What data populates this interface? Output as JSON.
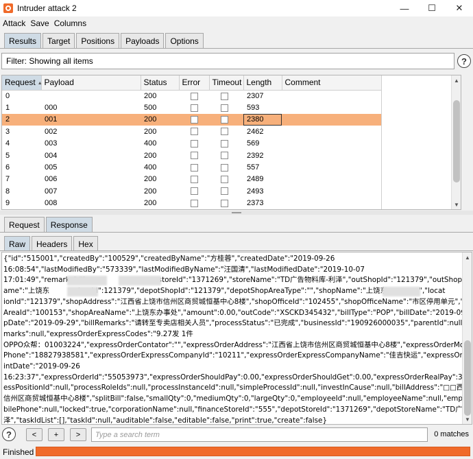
{
  "window": {
    "title": "Intruder attack 2"
  },
  "menu": [
    "Attack",
    "Save",
    "Columns"
  ],
  "main_tabs": [
    "Results",
    "Target",
    "Positions",
    "Payloads",
    "Options"
  ],
  "main_tabs_active": "Results",
  "filter": {
    "text": "Filter: Showing all items"
  },
  "table": {
    "columns": [
      "Request",
      "Payload",
      "Status",
      "Error",
      "Timeout",
      "Length",
      "Comment"
    ],
    "rows": [
      {
        "request": "0",
        "payload": "",
        "status": "200",
        "error": false,
        "timeout": false,
        "length": "2307",
        "comment": ""
      },
      {
        "request": "1",
        "payload": "000",
        "status": "500",
        "error": false,
        "timeout": false,
        "length": "593",
        "comment": ""
      },
      {
        "request": "2",
        "payload": "001",
        "status": "200",
        "error": false,
        "timeout": false,
        "length": "2380",
        "comment": ""
      },
      {
        "request": "3",
        "payload": "002",
        "status": "200",
        "error": false,
        "timeout": false,
        "length": "2462",
        "comment": ""
      },
      {
        "request": "4",
        "payload": "003",
        "status": "400",
        "error": false,
        "timeout": false,
        "length": "569",
        "comment": ""
      },
      {
        "request": "5",
        "payload": "004",
        "status": "200",
        "error": false,
        "timeout": false,
        "length": "2392",
        "comment": ""
      },
      {
        "request": "6",
        "payload": "005",
        "status": "400",
        "error": false,
        "timeout": false,
        "length": "557",
        "comment": ""
      },
      {
        "request": "7",
        "payload": "006",
        "status": "200",
        "error": false,
        "timeout": false,
        "length": "2489",
        "comment": ""
      },
      {
        "request": "8",
        "payload": "007",
        "status": "200",
        "error": false,
        "timeout": false,
        "length": "2493",
        "comment": ""
      },
      {
        "request": "9",
        "payload": "008",
        "status": "200",
        "error": false,
        "timeout": false,
        "length": "2373",
        "comment": ""
      }
    ],
    "selected_row": 2
  },
  "detail_tabs": [
    "Request",
    "Response"
  ],
  "detail_tabs_active": "Response",
  "view_tabs": [
    "Raw",
    "Headers",
    "Hex"
  ],
  "view_tabs_active": "Raw",
  "response_lines": [
    "{\"id\":\"515001\",\"createdBy\":\"100529\",\"createdByName\":\"方桂蓉\",\"createdDate\":\"2019-09-26",
    "16:08:54\",\"lastModifiedBy\":\"573339\",\"lastModifiedByName\":\"汪国清\",\"lastModifiedDate\":\"2019-10-07",
    "17:01:49\",\"remarks\":\"\",                              ,storeId\":\"1371269\",\"storeName\":\"TD广告物料库-利泽\",\"outShopId\":\"121379\",\"outShopN",
    "ame\":\"上饶东           shopId\":121379\",\"depotShopId\":\"121379\",\"depotShopAreaType\":\"\",\"shopName\":\"上饶东              \",\"locat",
    "ionId\":\"121379\",\"shopAddress\":\"江西省上饶市信州区商贸城恒基中心8楼\",\"shopOfficeId\":\"102455\",\"shopOfficeName\":\"市区停用单元\",\"shop",
    "AreaId\":\"100153\",\"shopAreaName\":\"上饶东办事处\",\"amount\":0.00,\"outCode\":\"XSCKD345432\",\"billType\":\"POP\",\"billDate\":\"2019-09-26\",\"shi",
    "pDate\":\"2019-09-29\",\"billRemarks\":\"请转至专卖店相关人员\",\"processStatus\":\"已完成\",\"businessId\":\"190926000035\",\"parentId\":null,\"signRe",
    "marks\":null,\"expressOrderExpressCodes\":\"9.27发 1件",
    "OPPO众帮：01003224\",\"expressOrderContator\":\"\",\"expressOrderAddress\":\"江西省上饶市信州区商贸城恒基中心8楼\",\"expressOrderMobile",
    "Phone\":\"18827938581\",\"expressOrderExpressCompanyId\":\"10211\",\"expressOrderExpressCompanyName\":\"佳吉快运\",\"expressOrderOutPr",
    "intDate\":\"2019-09-26",
    "16:23:37\",\"expressOrderId\":\"55053973\",\"expressOrderShouldPay\":0.00,\"expressOrderShouldGet\":0.00,\"expressOrderRealPay\":3.00,\"proc",
    "essPositionId\":null,\"processRoleIds\":null,\"processInstanceId\":null,\"simpleProcessId\":null,\"investInCause\":null,\"billAddress\":\"□□西省上饶市",
    "信州区商贸城恒基中心8楼\",\"splitBill\":false,\"smallQty\":0,\"mediumQty\":0,\"largeQty\":0,\"employeeId\":null,\"employeeName\":null,\"employeeMo",
    "bilePhone\":null,\"locked\":true,\"corporationName\":null,\"financeStoreId\":\"555\",\"depotStoreId\":\"1371269\",\"depotStoreName\":\"TD广告物料库-利",
    "泽\",\"taskIdList\":[],\"taskId\":null,\"auditable\":false,\"editable\":false,\"print\":true,\"create\":false}"
  ],
  "search": {
    "placeholder": "Type a search term",
    "matches": "0 matches"
  },
  "nav_buttons": [
    "<",
    "+",
    ">"
  ],
  "status": {
    "text": "Finished",
    "progress": 1.0
  },
  "colors": {
    "accent": "#f06a2a",
    "selected_row": "#f7b07b",
    "active_tab": "#cfdbe5"
  }
}
